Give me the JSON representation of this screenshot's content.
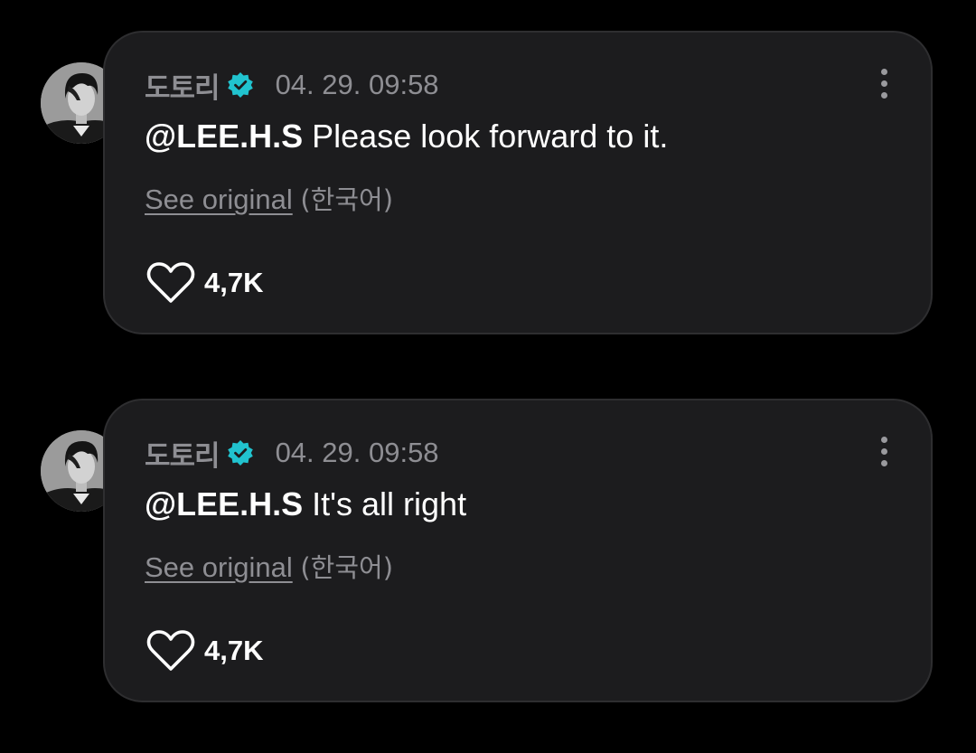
{
  "posts": [
    {
      "username": "도토리",
      "timestamp": "04. 29. 09:58",
      "mention": "@LEE.H.S",
      "text": " Please look forward to it.",
      "see_original": "See original",
      "language": "(한국어)",
      "likes": "4,7K",
      "verified": true
    },
    {
      "username": "도토리",
      "timestamp": "04. 29. 09:58",
      "mention": "@LEE.H.S",
      "text": " It's all right",
      "see_original": "See original",
      "language": "(한국어)",
      "likes": "4,7K",
      "verified": true
    }
  ],
  "colors": {
    "background": "#000000",
    "card": "#1c1c1e",
    "card_border": "#2e2e30",
    "muted_text": "#8e8e93",
    "verified_badge": "#21c3cf",
    "text": "#ffffff"
  },
  "icons": {
    "verified": "verified-badge-icon",
    "more": "more-vertical-icon",
    "like": "heart-outline-icon"
  }
}
